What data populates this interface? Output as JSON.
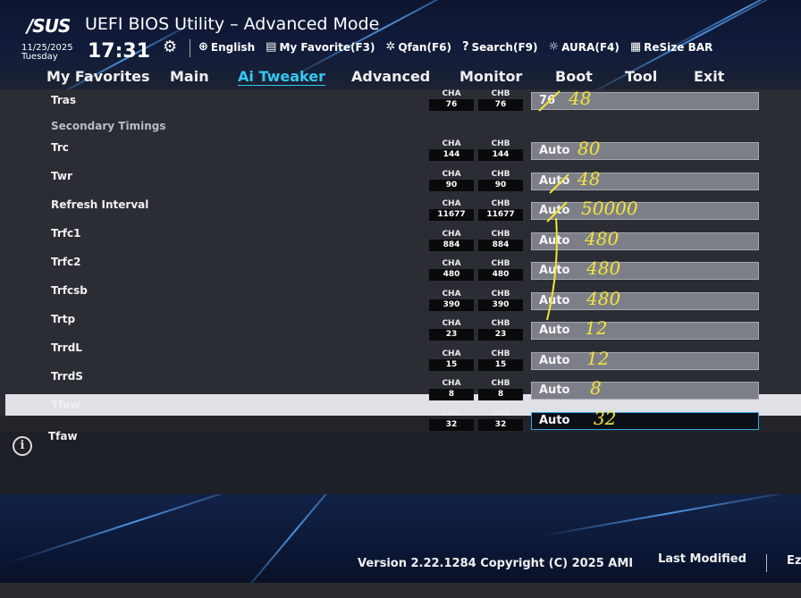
{
  "header": {
    "logo": "/SUS",
    "title": "UEFI BIOS Utility – Advanced Mode",
    "date": "11/25/2025",
    "day": "Tuesday",
    "time": "17:31",
    "tools": [
      {
        "icon": "globe-icon",
        "glyph": "⊕",
        "label": "English"
      },
      {
        "icon": "favorite-icon",
        "glyph": "▤",
        "label": "My Favorite(F3)"
      },
      {
        "icon": "fan-icon",
        "glyph": "✲",
        "label": "Qfan(F6)"
      },
      {
        "icon": "search-icon",
        "glyph": "?",
        "label": "Search(F9)"
      },
      {
        "icon": "aura-icon",
        "glyph": "☼",
        "label": "AURA(F4)"
      },
      {
        "icon": "resize-bar-icon",
        "glyph": "▦",
        "label": "ReSize BAR"
      }
    ]
  },
  "menu": {
    "tabs": [
      {
        "label": "My Favorites"
      },
      {
        "label": "Main"
      },
      {
        "label": "Ai Tweaker",
        "active": true
      },
      {
        "label": "Advanced"
      },
      {
        "label": "Monitor"
      },
      {
        "label": "Boot"
      },
      {
        "label": "Tool"
      },
      {
        "label": "Exit"
      }
    ]
  },
  "content": {
    "section_label": "Secondary Timings",
    "cha_label": "CHA",
    "chb_label": "CHB",
    "rows": [
      {
        "label": "Tras",
        "cha": "76",
        "chb": "76",
        "value": "76",
        "note": "48"
      },
      {
        "label": "Trc",
        "cha": "144",
        "chb": "144",
        "value": "Auto",
        "note": "80"
      },
      {
        "label": "Twr",
        "cha": "90",
        "chb": "90",
        "value": "Auto",
        "note": "48"
      },
      {
        "label": "Refresh Interval",
        "cha": "11677",
        "chb": "11677",
        "value": "Auto",
        "note": "50000"
      },
      {
        "label": "Trfc1",
        "cha": "884",
        "chb": "884",
        "value": "Auto",
        "note": "480"
      },
      {
        "label": "Trfc2",
        "cha": "480",
        "chb": "480",
        "value": "Auto",
        "note": "480"
      },
      {
        "label": "Trfcsb",
        "cha": "390",
        "chb": "390",
        "value": "Auto",
        "note": "480"
      },
      {
        "label": "Trtp",
        "cha": "23",
        "chb": "23",
        "value": "Auto",
        "note": "12"
      },
      {
        "label": "TrrdL",
        "cha": "15",
        "chb": "15",
        "value": "Auto",
        "note": "12"
      },
      {
        "label": "TrrdS",
        "cha": "8",
        "chb": "8",
        "value": "Auto",
        "note": "8"
      },
      {
        "label": "Tfaw",
        "cha": "32",
        "chb": "32",
        "value": "Auto",
        "note": "32",
        "selected": true
      }
    ]
  },
  "help": {
    "text": "Tfaw"
  },
  "footer": {
    "version": "Version 2.22.1284 Copyright (C) 2025 AMI",
    "last_modified": "Last Modified",
    "ez_mode": "Ez"
  },
  "colors": {
    "active_tab": "#34c8f0",
    "annotation": "#f3e33a",
    "selection_bar": "#dfe1e6",
    "field": "#7c7f88"
  }
}
